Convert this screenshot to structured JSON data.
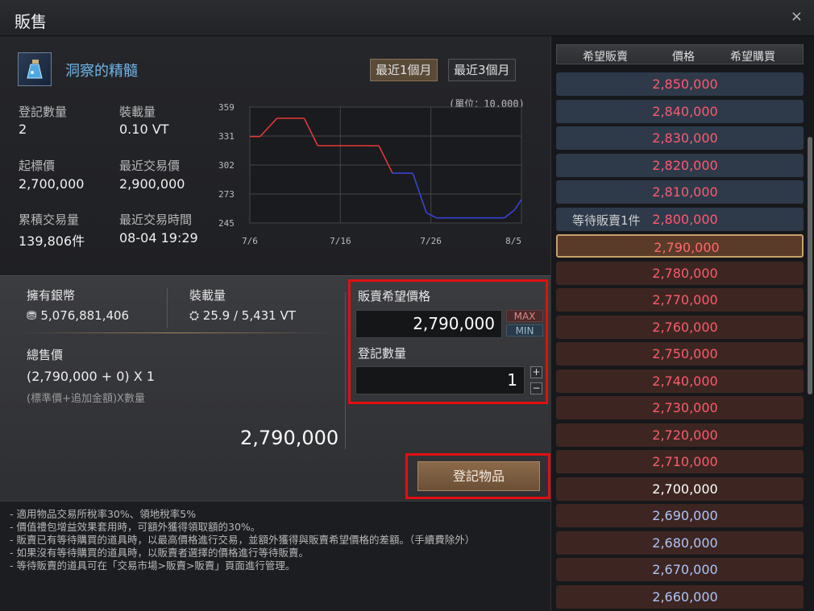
{
  "window": {
    "title": "販售",
    "close": "×"
  },
  "item": {
    "name": "洞察的精髓",
    "icon": "potion-bottle-icon"
  },
  "periods": [
    "最近1個月",
    "最近3個月"
  ],
  "stats": {
    "registered_label": "登記數量",
    "registered_value": "2",
    "weight_label": "裝載量",
    "weight_value": "0.10 VT",
    "base_price_label": "起標價",
    "base_price_value": "2,700,000",
    "last_price_label": "最近交易價",
    "last_price_value": "2,900,000",
    "total_trades_label": "累積交易量",
    "total_trades_value": "139,806件",
    "last_time_label": "最近交易時間",
    "last_time_value": "08-04 19:29"
  },
  "chart_data": {
    "type": "line",
    "unit_note": "(單位：10,000)",
    "y_ticks": [
      "359",
      "331",
      "302",
      "273",
      "245"
    ],
    "ylim": [
      245,
      359
    ],
    "x_ticks": [
      "7/6",
      "7/16",
      "7/26",
      "8/5"
    ],
    "series": [
      {
        "points": [
          [
            0,
            330
          ],
          [
            3,
            330
          ],
          [
            8,
            348
          ],
          [
            16,
            348
          ],
          [
            20,
            321
          ],
          [
            38,
            321
          ],
          [
            42,
            294
          ],
          [
            48,
            294
          ],
          [
            52,
            255
          ],
          [
            55,
            250
          ],
          [
            75,
            250
          ],
          [
            78,
            258
          ],
          [
            80,
            268
          ]
        ]
      }
    ],
    "colors": {
      "up": "#e63a3a",
      "down": "#3a46e6"
    }
  },
  "wallet": {
    "silver_label": "擁有銀幣",
    "silver_value": "5,076,881,406",
    "weight_label": "裝載量",
    "weight_value": "25.9 / 5,431 VT",
    "total_label": "總售價",
    "formula": "(2,790,000 + 0) X 1",
    "formula_note": "(標準價+追加金額)X數量",
    "total_value": "2,790,000"
  },
  "sell_form": {
    "price_label": "販賣希望價格",
    "price_value": "2,790,000",
    "max": "MAX",
    "min": "MIN",
    "qty_label": "登記數量",
    "qty_value": "1",
    "plus": "+",
    "minus": "−",
    "register_button": "登記物品"
  },
  "notes": [
    "- 適用物品交易所稅率30%、領地稅率5%",
    "- 價值禮包增益效果套用時，可額外獲得領取額的30%。",
    "",
    "- 販賣已有等待購買的道具時，以最高價格進行交易，並額外獲得與販賣希望價格的差額。（手續費除外）",
    "- 如果沒有等待購買的道具時，以販賣者選擇的價格進行等待販賣。",
    "- 等待販賣的道具可在「交易市場>販賣>販賣」頁面進行管理。"
  ],
  "orderbook": {
    "headers": [
      "希望販賣",
      "價格",
      "希望購買"
    ],
    "rows": [
      {
        "price": "2,850,000",
        "kind": "sell",
        "color": "#ff5a6a",
        "note": ""
      },
      {
        "price": "2,840,000",
        "kind": "sell",
        "color": "#ff5a6a",
        "note": ""
      },
      {
        "price": "2,830,000",
        "kind": "sell",
        "color": "#ff5a6a",
        "note": ""
      },
      {
        "price": "2,820,000",
        "kind": "sell",
        "color": "#ff5a6a",
        "note": ""
      },
      {
        "price": "2,810,000",
        "kind": "sell",
        "color": "#ff5a6a",
        "note": ""
      },
      {
        "price": "2,800,000",
        "kind": "sell",
        "color": "#ff5a6a",
        "note": "等待販賣1件"
      },
      {
        "price": "2,790,000",
        "kind": "mine",
        "color": "#ff6a6a",
        "note": ""
      },
      {
        "price": "2,780,000",
        "kind": "buy",
        "color": "#ff5a6a",
        "note": ""
      },
      {
        "price": "2,770,000",
        "kind": "buy",
        "color": "#ff5a6a",
        "note": ""
      },
      {
        "price": "2,760,000",
        "kind": "buy",
        "color": "#ff5a6a",
        "note": ""
      },
      {
        "price": "2,750,000",
        "kind": "buy",
        "color": "#ff5a6a",
        "note": ""
      },
      {
        "price": "2,740,000",
        "kind": "buy",
        "color": "#ff5a6a",
        "note": ""
      },
      {
        "price": "2,730,000",
        "kind": "buy",
        "color": "#ff5a6a",
        "note": ""
      },
      {
        "price": "2,720,000",
        "kind": "buy",
        "color": "#ff5a6a",
        "note": ""
      },
      {
        "price": "2,710,000",
        "kind": "buy",
        "color": "#ff5a6a",
        "note": ""
      },
      {
        "price": "2,700,000",
        "kind": "buy",
        "color": "#ffffff",
        "note": ""
      },
      {
        "price": "2,690,000",
        "kind": "buy",
        "color": "#a9c4ff",
        "note": ""
      },
      {
        "price": "2,680,000",
        "kind": "buy",
        "color": "#a9c4ff",
        "note": ""
      },
      {
        "price": "2,670,000",
        "kind": "buy",
        "color": "#a9c4ff",
        "note": ""
      },
      {
        "price": "2,660,000",
        "kind": "buy",
        "color": "#a9c4ff",
        "note": ""
      }
    ]
  }
}
